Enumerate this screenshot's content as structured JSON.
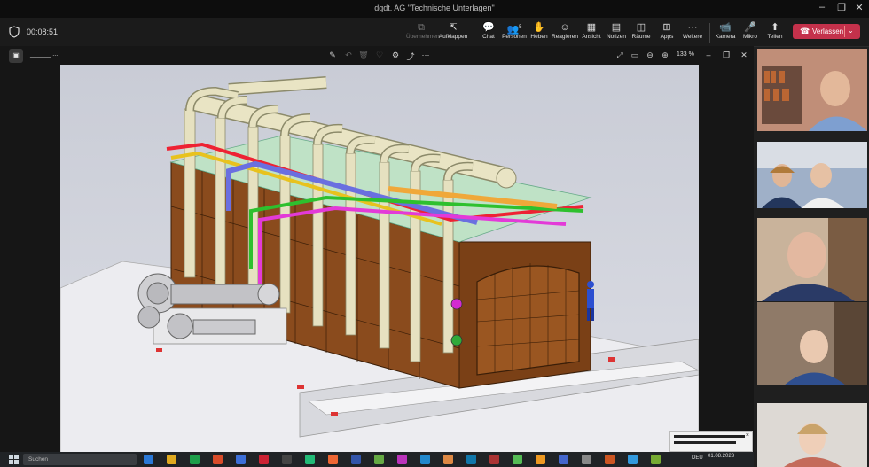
{
  "window": {
    "title": "dgdt. AG \"Technische Unterlagen\"",
    "controls": [
      "minimize",
      "maximize",
      "close"
    ]
  },
  "meeting": {
    "name": "00:08:51"
  },
  "toolbar": {
    "items": [
      {
        "label": "Übernehmen",
        "icon": "take-control-icon",
        "disabled": true
      },
      {
        "label": "Aufklappen",
        "icon": "popout-icon"
      },
      {
        "label": "Chat",
        "icon": "chat-icon"
      },
      {
        "label": "Personen",
        "icon": "people-icon",
        "badge": "5"
      },
      {
        "label": "Heben",
        "icon": "raise-hand-icon"
      },
      {
        "label": "Reagieren",
        "icon": "react-icon"
      },
      {
        "label": "Ansicht",
        "icon": "view-icon"
      },
      {
        "label": "Notizen",
        "icon": "notes-icon"
      },
      {
        "label": "Räume",
        "icon": "rooms-icon"
      },
      {
        "label": "Apps",
        "icon": "apps-icon"
      },
      {
        "label": "Weitere",
        "icon": "more-icon"
      },
      {
        "label": "Kamera",
        "icon": "camera-icon"
      },
      {
        "label": "Mikro",
        "icon": "microphone-icon"
      },
      {
        "label": "Teilen",
        "icon": "share-icon"
      }
    ],
    "leave_label": "Verlassen"
  },
  "share": {
    "owner": "______ ...",
    "zoom": "133 %"
  },
  "taskbar": {
    "search_placeholder": "Suchen",
    "language": "DEU",
    "date": "01.08.2023"
  },
  "colors": {
    "leave": "#c4314b",
    "steel": "#8a4b1d",
    "pipe": "#e6e1c0"
  }
}
